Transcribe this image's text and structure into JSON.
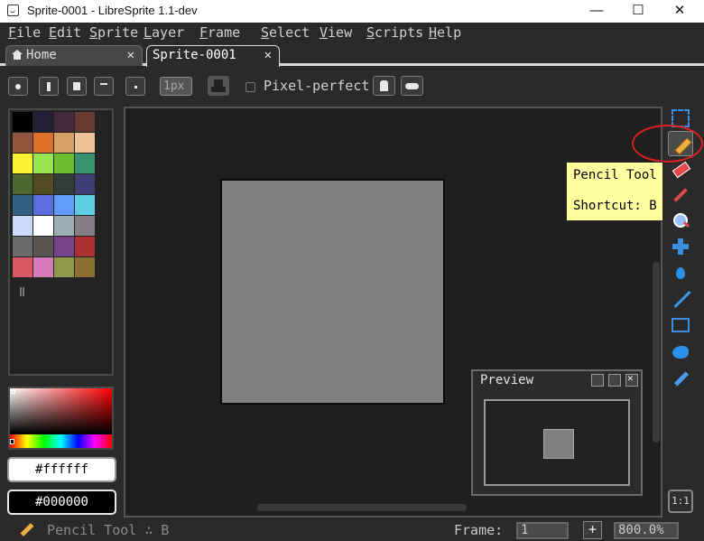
{
  "window": {
    "title": "Sprite-0001 - LibreSprite 1.1-dev",
    "controls": {
      "minimize": "—",
      "maximize": "☐",
      "close": "✕"
    }
  },
  "menu": {
    "items": [
      {
        "first": "F",
        "rest": "ile"
      },
      {
        "first": "E",
        "rest": "dit"
      },
      {
        "first": "S",
        "rest": "prite"
      },
      {
        "first": "L",
        "rest": "ayer"
      },
      {
        "first": "F",
        "rest": "rame"
      },
      {
        "first": "S",
        "rest": "elect"
      },
      {
        "first": "V",
        "rest": "iew"
      },
      {
        "first": "S",
        "rest": "cripts"
      },
      {
        "first": "H",
        "rest": "elp"
      }
    ]
  },
  "tabs": [
    {
      "label": "Home",
      "close": "✕"
    },
    {
      "label": "Sprite-0001",
      "close": "✕"
    }
  ],
  "context": {
    "brush_size": "1px",
    "pixel_perfect_label": "Pixel-perfect",
    "pixel_perfect_checked": false
  },
  "palette": {
    "colors": [
      "#000000",
      "#222034",
      "#45283c",
      "#663931",
      "#8f563b",
      "#df7126",
      "#d9a066",
      "#eec39a",
      "#fbf236",
      "#99e550",
      "#6abe30",
      "#37946e",
      "#4b692f",
      "#524b24",
      "#323c39",
      "#3f3f74",
      "#306082",
      "#5b6ee1",
      "#639bff",
      "#5fcde4",
      "#cbdbfc",
      "#ffffff",
      "#9badb7",
      "#847e87",
      "#696a6a",
      "#595652",
      "#76428a",
      "#ac3232",
      "#d95763",
      "#d77bba",
      "#8f974a",
      "#8a6f30"
    ]
  },
  "colors": {
    "foreground": "#ffffff",
    "background": "#000000"
  },
  "preview": {
    "title": "Preview"
  },
  "toolbar": {
    "tools": [
      "marquee-icon",
      "pencil-icon",
      "eraser-icon",
      "eyedropper-icon",
      "zoom-icon",
      "move-icon",
      "paint-bucket-icon",
      "line-icon",
      "rectangle-icon",
      "blob-icon",
      "spray-icon"
    ],
    "active_tool": "pencil-icon",
    "ratio_button": "1:1"
  },
  "tooltip": {
    "title": "Pencil Tool",
    "shortcut": "Shortcut: B"
  },
  "status": {
    "tool_text": "Pencil Tool ∴ B",
    "frame_label": "Frame:",
    "frame_value": "1",
    "add_frame": "+",
    "zoom": "800.0%"
  }
}
